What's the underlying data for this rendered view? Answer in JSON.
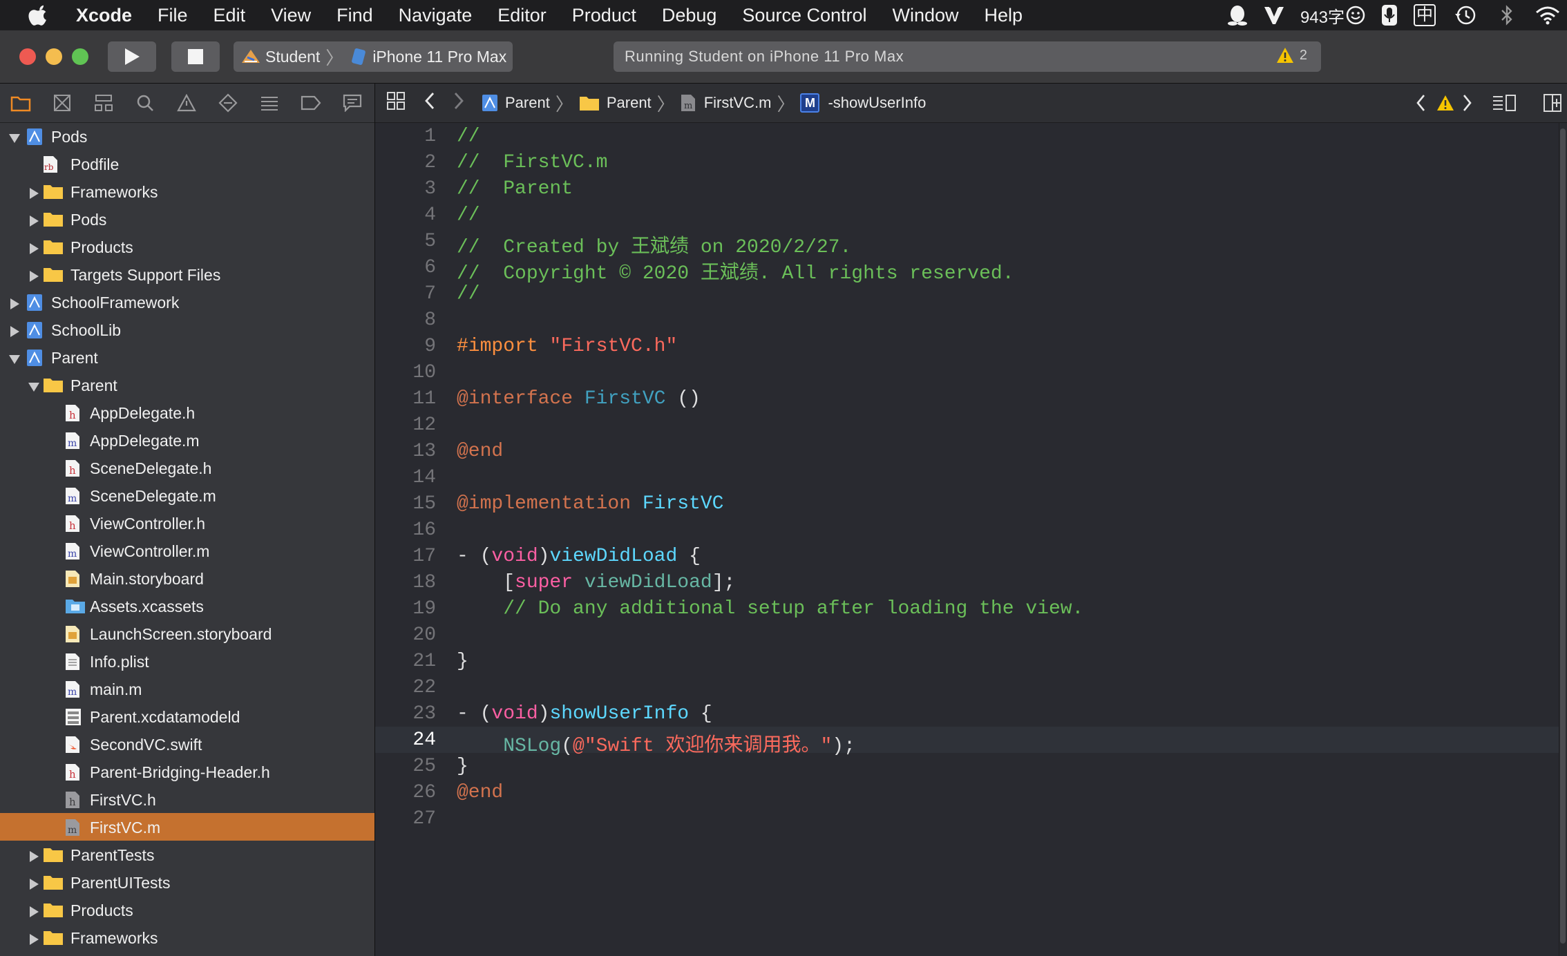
{
  "menubar": {
    "items": [
      "Xcode",
      "File",
      "Edit",
      "View",
      "Find",
      "Navigate",
      "Editor",
      "Product",
      "Debug",
      "Source Control",
      "Window",
      "Help"
    ],
    "status": {
      "word_count": "943字",
      "input_method": "中"
    }
  },
  "toolbar": {
    "scheme": "Student",
    "destination": "iPhone 11 Pro Max",
    "activity": "Running Student on iPhone 11 Pro Max",
    "warning_count": "2"
  },
  "navigator": {
    "tree": [
      {
        "label": "Pods",
        "level": 0,
        "kind": "project",
        "disclosure": "open"
      },
      {
        "label": "Podfile",
        "level": 1,
        "kind": "ruby",
        "disclosure": "none"
      },
      {
        "label": "Frameworks",
        "level": 1,
        "kind": "folder",
        "disclosure": "closed"
      },
      {
        "label": "Pods",
        "level": 1,
        "kind": "folder",
        "disclosure": "closed"
      },
      {
        "label": "Products",
        "level": 1,
        "kind": "folder",
        "disclosure": "closed"
      },
      {
        "label": "Targets Support Files",
        "level": 1,
        "kind": "folder",
        "disclosure": "closed"
      },
      {
        "label": "SchoolFramework",
        "level": 0,
        "kind": "project",
        "disclosure": "closed"
      },
      {
        "label": "SchoolLib",
        "level": 0,
        "kind": "project",
        "disclosure": "closed"
      },
      {
        "label": "Parent",
        "level": 0,
        "kind": "project",
        "disclosure": "open"
      },
      {
        "label": "Parent",
        "level": 1,
        "kind": "folder",
        "disclosure": "open"
      },
      {
        "label": "AppDelegate.h",
        "level": 2,
        "kind": "h",
        "disclosure": "none"
      },
      {
        "label": "AppDelegate.m",
        "level": 2,
        "kind": "m",
        "disclosure": "none"
      },
      {
        "label": "SceneDelegate.h",
        "level": 2,
        "kind": "h",
        "disclosure": "none"
      },
      {
        "label": "SceneDelegate.m",
        "level": 2,
        "kind": "m",
        "disclosure": "none"
      },
      {
        "label": "ViewController.h",
        "level": 2,
        "kind": "h",
        "disclosure": "none"
      },
      {
        "label": "ViewController.m",
        "level": 2,
        "kind": "m",
        "disclosure": "none"
      },
      {
        "label": "Main.storyboard",
        "level": 2,
        "kind": "storyboard",
        "disclosure": "none"
      },
      {
        "label": "Assets.xcassets",
        "level": 2,
        "kind": "assets",
        "disclosure": "none"
      },
      {
        "label": "LaunchScreen.storyboard",
        "level": 2,
        "kind": "storyboard",
        "disclosure": "none"
      },
      {
        "label": "Info.plist",
        "level": 2,
        "kind": "plist",
        "disclosure": "none"
      },
      {
        "label": "main.m",
        "level": 2,
        "kind": "m",
        "disclosure": "none"
      },
      {
        "label": "Parent.xcdatamodeld",
        "level": 2,
        "kind": "datamodel",
        "disclosure": "none"
      },
      {
        "label": "SecondVC.swift",
        "level": 2,
        "kind": "swift",
        "disclosure": "none"
      },
      {
        "label": "Parent-Bridging-Header.h",
        "level": 2,
        "kind": "h",
        "disclosure": "none"
      },
      {
        "label": "FirstVC.h",
        "level": 2,
        "kind": "h-gray",
        "disclosure": "none"
      },
      {
        "label": "FirstVC.m",
        "level": 2,
        "kind": "m-gray",
        "disclosure": "none",
        "selected": true
      },
      {
        "label": "ParentTests",
        "level": 1,
        "kind": "folder",
        "disclosure": "closed"
      },
      {
        "label": "ParentUITests",
        "level": 1,
        "kind": "folder",
        "disclosure": "closed"
      },
      {
        "label": "Products",
        "level": 1,
        "kind": "folder",
        "disclosure": "closed"
      },
      {
        "label": "Frameworks",
        "level": 1,
        "kind": "folder",
        "disclosure": "closed"
      }
    ]
  },
  "jumpbar": {
    "crumbs": [
      "Parent",
      "Parent",
      "FirstVC.m",
      "-showUserInfo"
    ],
    "method_badge": "M"
  },
  "editor": {
    "current_line": 24,
    "lines": [
      [
        {
          "t": "//",
          "c": "comment"
        }
      ],
      [
        {
          "t": "//  FirstVC.m",
          "c": "comment"
        }
      ],
      [
        {
          "t": "//  Parent",
          "c": "comment"
        }
      ],
      [
        {
          "t": "//",
          "c": "comment"
        }
      ],
      [
        {
          "t": "//  Created by 王斌绩 on 2020/2/27.",
          "c": "comment"
        }
      ],
      [
        {
          "t": "//  Copyright © 2020 王斌绩. All rights reserved.",
          "c": "comment"
        }
      ],
      [
        {
          "t": "//",
          "c": "comment"
        }
      ],
      [],
      [
        {
          "t": "#import ",
          "c": "preproc"
        },
        {
          "t": "\"FirstVC.h\"",
          "c": "str"
        }
      ],
      [],
      [
        {
          "t": "@interface ",
          "c": "keyword2"
        },
        {
          "t": "FirstVC",
          "c": "cls2"
        },
        {
          "t": " ()",
          "c": ""
        }
      ],
      [],
      [
        {
          "t": "@end",
          "c": "keyword2"
        }
      ],
      [],
      [
        {
          "t": "@implementation ",
          "c": "keyword2"
        },
        {
          "t": "FirstVC",
          "c": "cls"
        }
      ],
      [],
      [
        {
          "t": "- (",
          "c": ""
        },
        {
          "t": "void",
          "c": "keyword"
        },
        {
          "t": ")",
          "c": ""
        },
        {
          "t": "viewDidLoad",
          "c": "cls"
        },
        {
          "t": " {",
          "c": ""
        }
      ],
      [
        {
          "t": "    [",
          "c": ""
        },
        {
          "t": "super",
          "c": "keyword"
        },
        {
          "t": " ",
          "c": ""
        },
        {
          "t": "viewDidLoad",
          "c": "method"
        },
        {
          "t": "];",
          "c": ""
        }
      ],
      [
        {
          "t": "    // Do any additional setup after loading the view.",
          "c": "comment"
        }
      ],
      [],
      [
        {
          "t": "}",
          "c": ""
        }
      ],
      [],
      [
        {
          "t": "- (",
          "c": ""
        },
        {
          "t": "void",
          "c": "keyword"
        },
        {
          "t": ")",
          "c": ""
        },
        {
          "t": "showUserInfo",
          "c": "cls"
        },
        {
          "t": " {",
          "c": ""
        }
      ],
      [
        {
          "t": "    ",
          "c": ""
        },
        {
          "t": "NSLog",
          "c": "method"
        },
        {
          "t": "(",
          "c": ""
        },
        {
          "t": "@\"Swift 欢迎你来调用我。\"",
          "c": "str"
        },
        {
          "t": ");",
          "c": ""
        }
      ],
      [
        {
          "t": "}",
          "c": ""
        }
      ],
      [
        {
          "t": "@end",
          "c": "keyword2"
        }
      ],
      []
    ]
  },
  "colors": {
    "selection": "#c5712f",
    "comment": "#6bbf59",
    "keyword": "#fc5fa3",
    "string": "#fc6a5d",
    "type": "#5dd8ff"
  }
}
